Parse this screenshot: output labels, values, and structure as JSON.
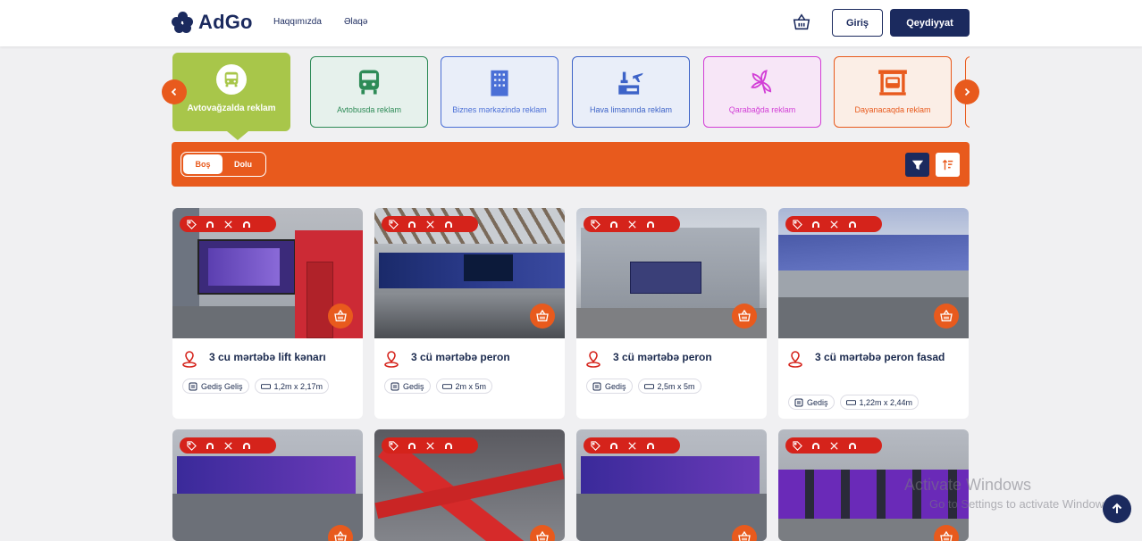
{
  "header": {
    "logo": "AdGo",
    "nav": [
      {
        "label": "Haqqımızda"
      },
      {
        "label": "Əlaqə"
      }
    ],
    "login_label": "Giriş",
    "register_label": "Qeydiyyat"
  },
  "categories": [
    {
      "label": "Avtovağzalda reklam",
      "active": true,
      "color": "#a8c64a",
      "icon": "bus-front-icon"
    },
    {
      "label": "Avtobusda reklam",
      "color": "#2e8b57",
      "bg": "#e6f1ec",
      "icon": "bus-icon"
    },
    {
      "label": "Biznes mərkəzində reklam",
      "color": "#4a6fd6",
      "bg": "#e9eef9",
      "icon": "building-icon"
    },
    {
      "label": "Hava limanında reklam",
      "color": "#3d63c8",
      "bg": "#e9eef9",
      "icon": "airport-icon"
    },
    {
      "label": "Qarabağda reklam",
      "color": "#d23fd6",
      "bg": "#f7e6f7",
      "icon": "flower-icon"
    },
    {
      "label": "Dayanacaqda reklam",
      "color": "#e85a1d",
      "bg": "#fbeee6",
      "icon": "bus-stop-icon"
    }
  ],
  "filter": {
    "options": [
      "Boş",
      "Dolu"
    ],
    "selected": "Boş"
  },
  "cards": [
    {
      "title": "3 cu mərtəbə lift kənarı",
      "direction": "Gediş Geliş",
      "size": "1,2m x 2,17m"
    },
    {
      "title": "3 cü mərtəbə peron",
      "direction": "Gediş",
      "size": "2m x 5m"
    },
    {
      "title": "3 cü mərtəbə peron",
      "direction": "Gediş",
      "size": "2,5m x 5m"
    },
    {
      "title": "3 cü mərtəbə peron fasad",
      "direction": "Gediş",
      "size": "1,22m x 2,44m"
    },
    {
      "title": "",
      "direction": "",
      "size": ""
    },
    {
      "title": "",
      "direction": "",
      "size": ""
    },
    {
      "title": "",
      "direction": "",
      "size": ""
    },
    {
      "title": "",
      "direction": "",
      "size": ""
    }
  ],
  "watermark": {
    "line1": "Activate Windows",
    "line2": "Go to Settings to activate Windows."
  },
  "colors": {
    "brand_navy": "#1b2a5e",
    "accent_orange": "#e85a1d",
    "tag_red": "#d5231b",
    "active_green": "#a8c64a"
  }
}
